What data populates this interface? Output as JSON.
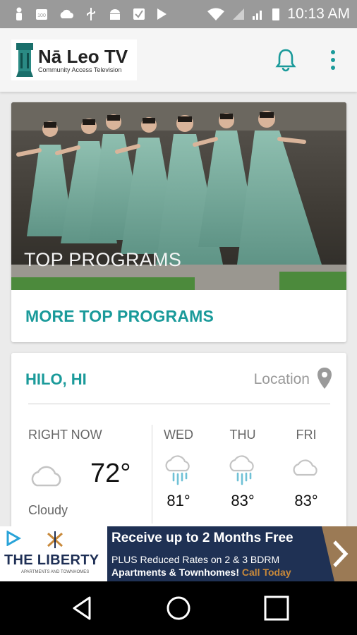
{
  "status_bar": {
    "time": "10:13 AM",
    "icons": [
      "person-icon",
      "badge-100-icon",
      "cloud-icon",
      "usb-icon",
      "android-icon",
      "check-icon",
      "play-store-icon",
      "wifi-icon",
      "no-signal-icon",
      "signal-icon",
      "battery-icon"
    ]
  },
  "app_bar": {
    "logo_title": "Nā Leo TV",
    "logo_subtitle": "Community Access Television",
    "icons": [
      "bell-icon",
      "more-vert-icon"
    ],
    "accent_color": "#1a9a9a"
  },
  "top_programs": {
    "hero_label": "TOP PROGRAMS",
    "more_link": "MORE TOP PROGRAMS"
  },
  "weather": {
    "city": "HILO, HI",
    "location_label": "Location",
    "now": {
      "label": "RIGHT NOW",
      "temp": "72°",
      "condition": "Cloudy",
      "icon": "cloud-icon"
    },
    "forecast": [
      {
        "day": "WED",
        "temp": "81°",
        "icon": "rain-cloud-icon"
      },
      {
        "day": "THU",
        "temp": "83°",
        "icon": "rain-cloud-icon"
      },
      {
        "day": "FRI",
        "temp": "83°",
        "icon": "cloud-icon"
      }
    ]
  },
  "ad": {
    "brand": "THE LIBERTY",
    "brand_sub": "APARTMENTS AND TOWNHOMES",
    "headline": "Receive up to 2 Months Free",
    "line2": "PLUS Reduced Rates on 2 & 3 BDRM",
    "line3_main": "Apartments & Townhomes!",
    "line3_call": "Call Today"
  },
  "nav_bar": {
    "icons": [
      "back-icon",
      "home-icon",
      "recents-icon"
    ]
  }
}
